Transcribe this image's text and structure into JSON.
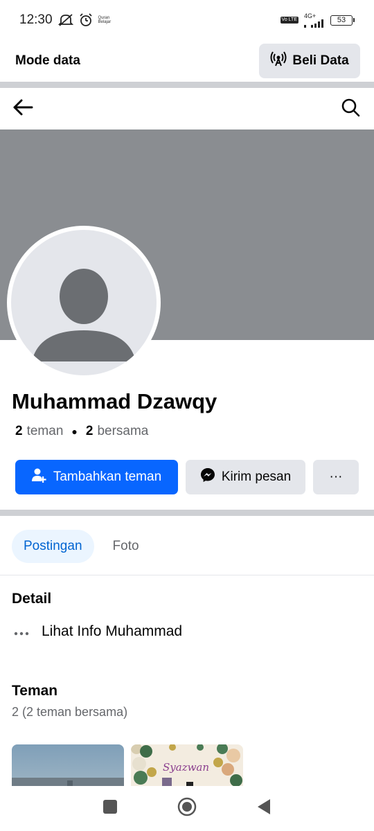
{
  "status": {
    "time": "12:30",
    "quran_label": "Quran Belajar",
    "volte": "Vo LTE",
    "network": "4G+",
    "battery": "53"
  },
  "data_bar": {
    "title": "Mode data",
    "buy_label": "Beli Data"
  },
  "profile": {
    "name": "Muhammad Dzawqy",
    "friends_count": "2",
    "friends_label": "teman",
    "mutual_count": "2",
    "mutual_label": "bersama"
  },
  "actions": {
    "add_friend": "Tambahkan teman",
    "message": "Kirim pesan",
    "more": "···"
  },
  "tabs": [
    {
      "label": "Postingan",
      "active": true
    },
    {
      "label": "Foto",
      "active": false
    }
  ],
  "details": {
    "title": "Detail",
    "info_label": "Lihat Info Muhammad"
  },
  "friends": {
    "title": "Teman",
    "subtitle": "2 (2 teman bersama)",
    "thumbnails": [
      {
        "caption": ""
      },
      {
        "caption": "Syazwan"
      }
    ]
  },
  "colors": {
    "primary": "#0866ff",
    "secondary_bg": "#e4e6eb",
    "cover": "#8a8d91",
    "active_tab_bg": "#ebf5ff",
    "active_tab_text": "#0064d1"
  }
}
